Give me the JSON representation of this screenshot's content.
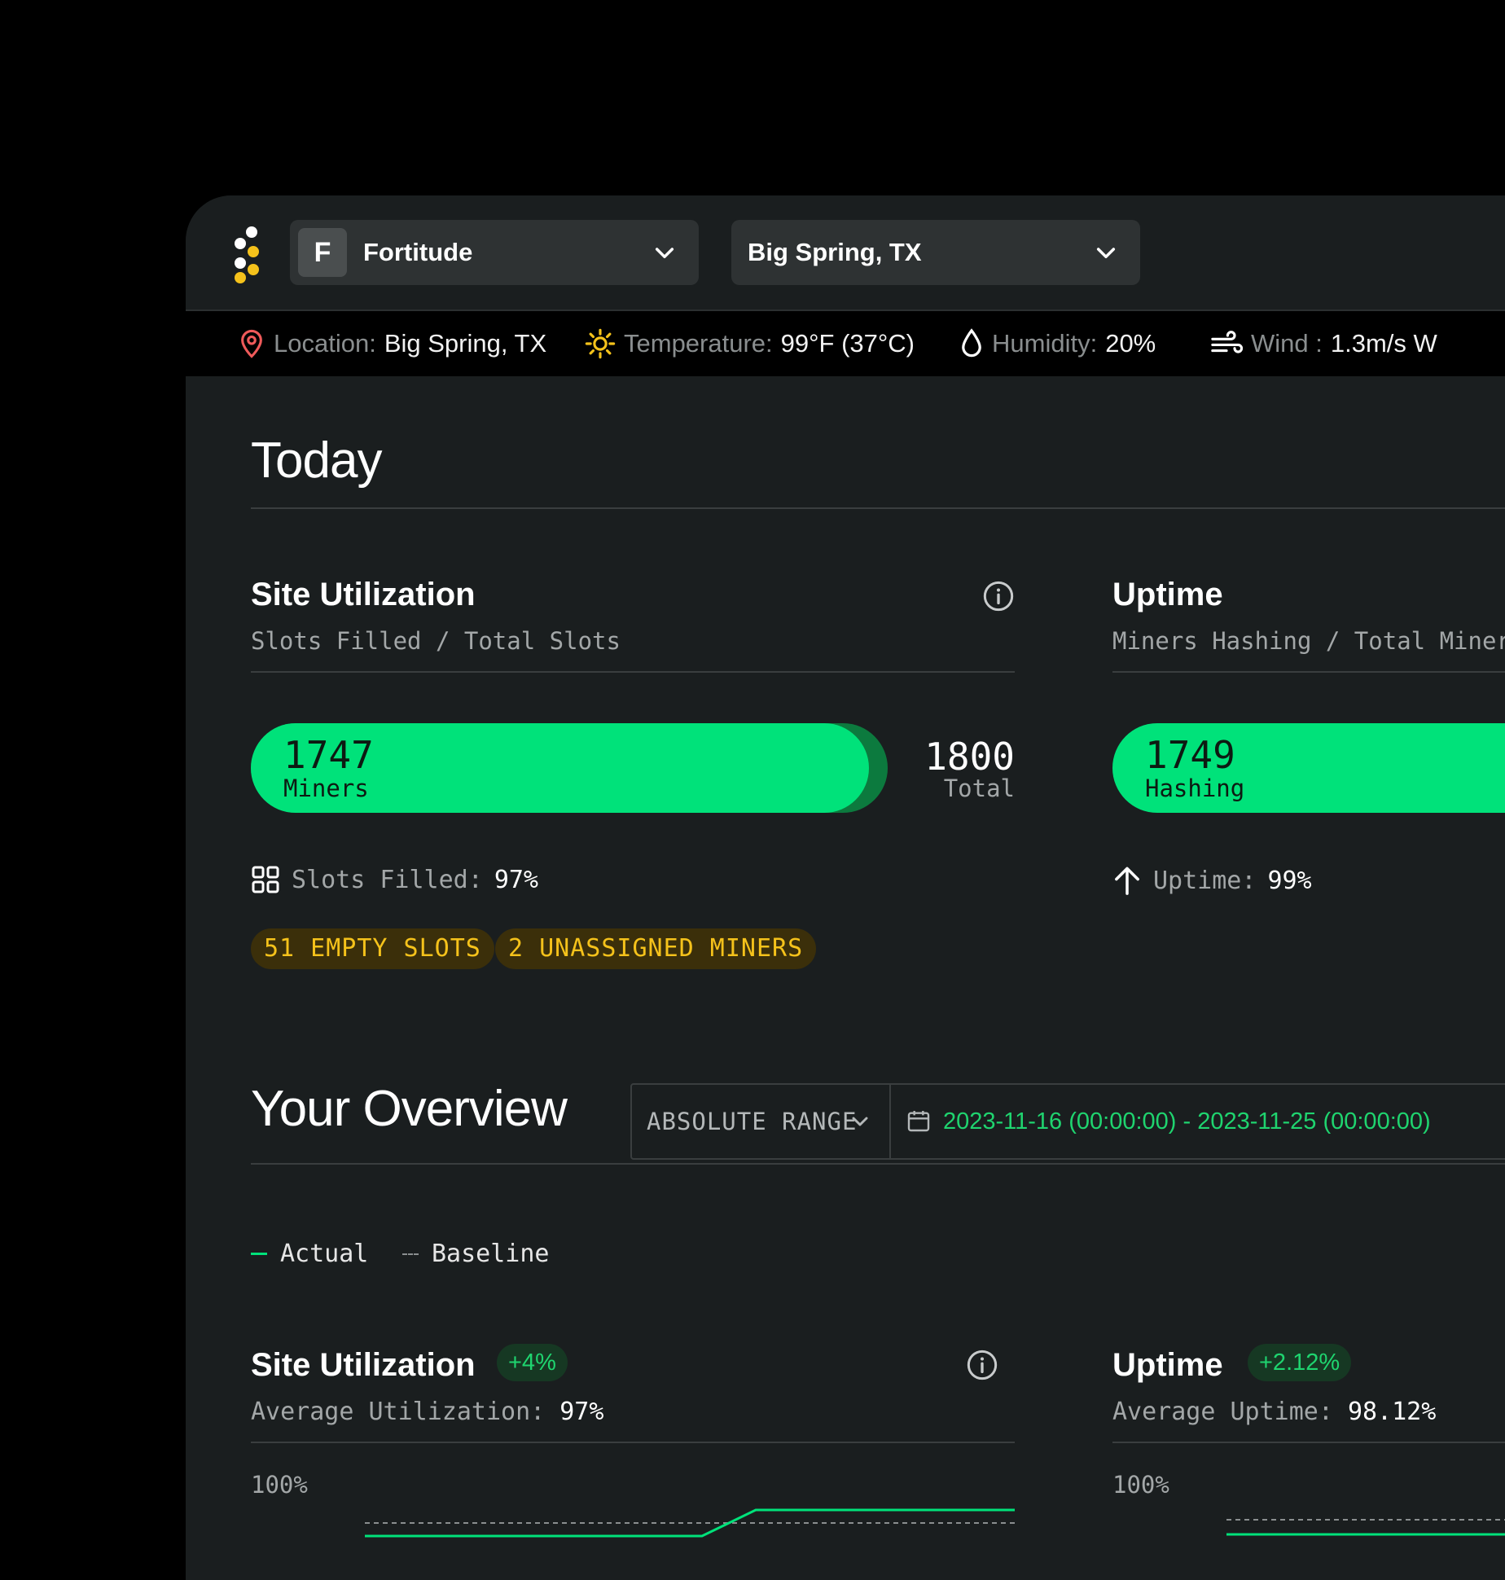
{
  "header": {
    "org": {
      "letter": "F",
      "name": "Fortitude"
    },
    "site": {
      "name": "Big Spring, TX"
    }
  },
  "weather": {
    "location": {
      "label": "Location:",
      "value": "Big Spring, TX"
    },
    "temperature": {
      "label": "Temperature:",
      "value": "99°F (37°C)"
    },
    "humidity": {
      "label": "Humidity:",
      "value": "20%"
    },
    "wind": {
      "label": "Wind :",
      "value": "1.3m/s W"
    }
  },
  "today": {
    "title": "Today",
    "site_utilization": {
      "title": "Site Utilization",
      "subtitle": "Slots Filled / Total Slots",
      "filled": "1747",
      "filled_caption": "Miners",
      "total": "1800",
      "total_caption": "Total",
      "fill_fraction": 0.97,
      "stat_label": "Slots Filled:",
      "stat_value": "97%",
      "badges": [
        "51 EMPTY SLOTS",
        "2 UNASSIGNED MINERS"
      ]
    },
    "uptime": {
      "title": "Uptime",
      "subtitle": "Miners Hashing / Total Miners",
      "hashing": "1749",
      "hashing_caption": "Hashing",
      "stat_label": "Uptime:",
      "stat_value": "99%"
    }
  },
  "overview": {
    "title": "Your Overview",
    "range_mode": "ABSOLUTE RANGE",
    "date_range": "2023-11-16 (00:00:00) - 2023-11-25 (00:00:00)",
    "legend": {
      "actual": "Actual",
      "baseline": "Baseline"
    },
    "site_utilization": {
      "title": "Site Utilization",
      "delta": "+4%",
      "avg_label": "Average Utilization:",
      "avg_value": "97%",
      "y_top": "100%"
    },
    "uptime": {
      "title": "Uptime",
      "delta": "+2.12%",
      "avg_label": "Average Uptime:",
      "avg_value": "98.12%",
      "y_top": "100%"
    }
  },
  "colors": {
    "accent_green": "#00e27a",
    "warning_yellow": "#f5c21b",
    "background": "#1a1e1f"
  }
}
